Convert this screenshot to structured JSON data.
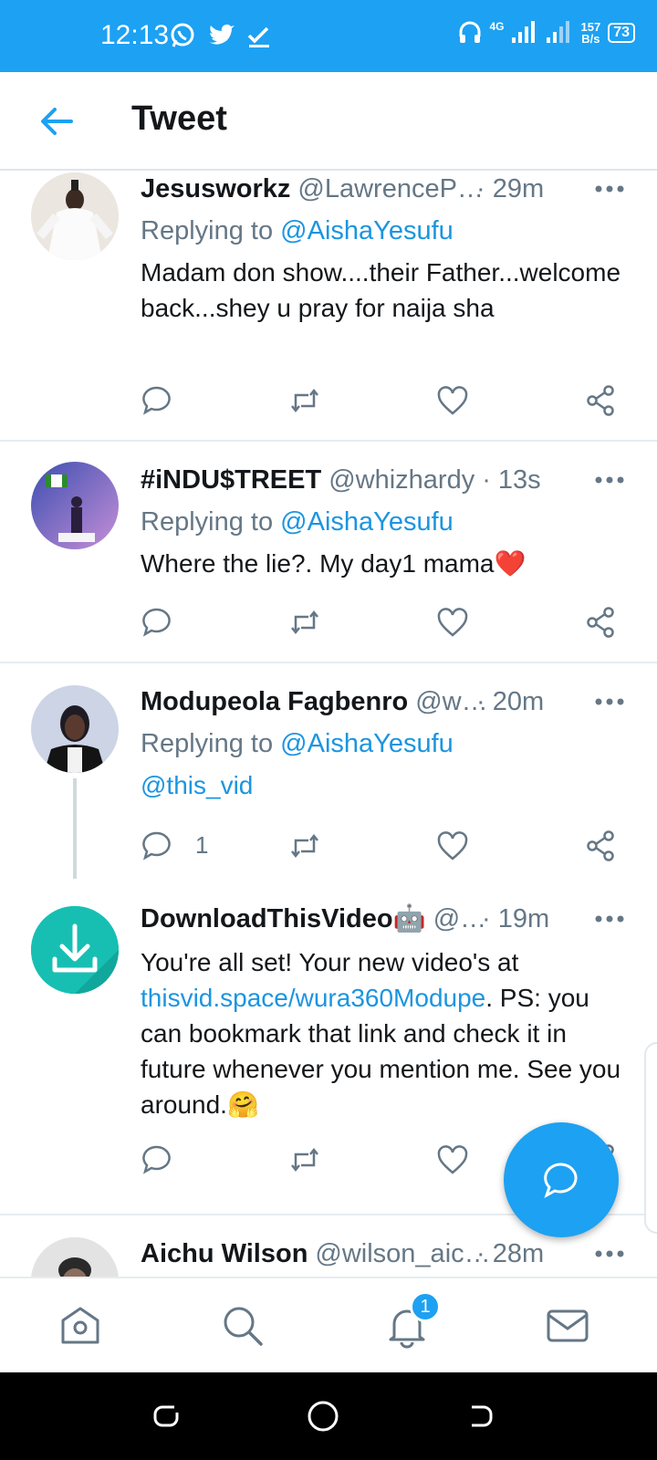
{
  "status_bar": {
    "time": "12:13",
    "network": "4G",
    "speed_value": "157",
    "speed_unit": "B/s",
    "battery": "73"
  },
  "header": {
    "title": "Tweet"
  },
  "tweets": [
    {
      "name": "Jesusworkz",
      "handle": "@LawrenceP…",
      "time": "· 29m",
      "replying_label": "Replying to",
      "replying_to": "@AishaYesufu",
      "text": "Madam don show....their Father...welcome back...shey u pray for naija sha"
    },
    {
      "name": "#iNDU$TREET",
      "handle": "@whizhardy",
      "time": "· 13s",
      "replying_label": "Replying to",
      "replying_to": "@AishaYesufu",
      "text": "Where the lie?. My day1 mama",
      "emoji": "❤️"
    },
    {
      "name": "Modupeola Fagbenro",
      "handle": "@w…",
      "time": "· 20m",
      "replying_label": "Replying to",
      "replying_to": "@AishaYesufu",
      "text": "@this_vid",
      "reply_count": "1"
    },
    {
      "name": "DownloadThisVideo",
      "name_emoji": "🤖",
      "handle": "@…",
      "time": "· 19m",
      "text_before": "You're all set! Your new video's at ",
      "link": "thisvid.space/wura360Modupe",
      "text_after": ". PS: you can bookmark that link and check it in future whenever you mention me. See you around.",
      "emoji": "🤗"
    },
    {
      "name": "Aichu Wilson",
      "handle": "@wilson_aic…",
      "time": "· 28m"
    }
  ],
  "bottom_nav": {
    "notification_badge": "1"
  },
  "colors": {
    "accent": "#1da1f2",
    "link": "#1b95e0",
    "muted": "#657786",
    "heart": "#e0245e"
  }
}
